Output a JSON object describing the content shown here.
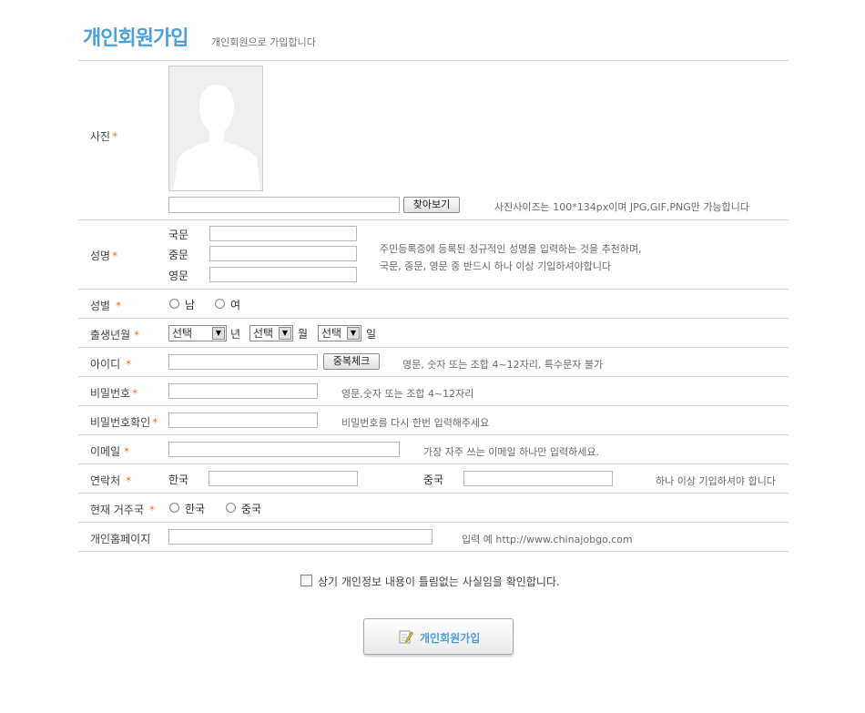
{
  "header": {
    "title": "개인회원가입",
    "subtitle": "개인회원으로 가입합니다"
  },
  "required_mark": "*",
  "photo": {
    "label": "사진",
    "browse_button": "찾아보기",
    "hint": "사진사이즈는 100*134px이며 JPG,GIF,PNG만 가능합니다"
  },
  "name": {
    "label": "성명",
    "korean": "국문",
    "chinese": "중문",
    "english": "영문",
    "hint_line1": "주민등록증에 등록된 정규적인 성명을 입력하는 것을 추천하며,",
    "hint_line2": "국문, 중문, 영문 중 반드시 하나 이상 기입하셔야합니다"
  },
  "gender": {
    "label": "성별",
    "male": "남",
    "female": "여"
  },
  "birth": {
    "label": "출생년월",
    "select_placeholder": "선택",
    "year_unit": "년",
    "month_unit": "월",
    "day_unit": "일"
  },
  "userid": {
    "label": "아이디",
    "check_button": "중복체크",
    "hint": "영문, 숫자 또는 조합 4~12자리, 특수문자 불가"
  },
  "password": {
    "label": "비밀번호",
    "hint": "영문,숫자 또는 조합 4~12자리"
  },
  "password_confirm": {
    "label": "비밀번호확인",
    "hint": "비밀번호를 다시 한번 입력해주세요"
  },
  "email": {
    "label": "이메일",
    "hint": "가장 자주 쓰는 이메일 하나만 입력하세요."
  },
  "contact": {
    "label": "연락처",
    "korea": "한국",
    "china": "중국",
    "hint": "하나 이상 기입하셔야 합니다"
  },
  "residence": {
    "label": "현재 거주국",
    "korea": "한국",
    "china": "중국"
  },
  "homepage": {
    "label": "개인홈페이지",
    "hint": "입력 예  http://www.chinajobgo.com"
  },
  "agreement": {
    "text": "상기 개인정보 내용이 틀림없는 사실임을 확인합니다."
  },
  "submit": {
    "label": "개인회원가입"
  },
  "colors": {
    "accent": "#4f9fd8",
    "required": "#e27b2c",
    "border": "#d5d5d5"
  }
}
